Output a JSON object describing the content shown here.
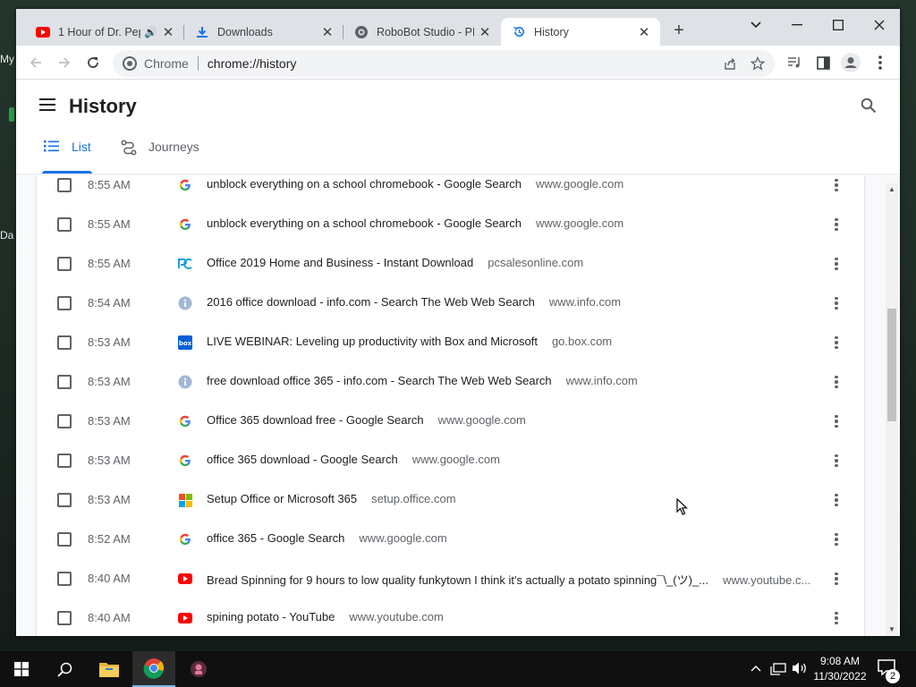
{
  "desktop": {
    "fragment_1": "My",
    "fragment_2": "Da"
  },
  "tabs": [
    {
      "title": "1 Hour of Dr. Pep",
      "icon": "youtube-icon",
      "audio": "🔊"
    },
    {
      "title": "Downloads",
      "icon": "download-icon"
    },
    {
      "title": "RoboBot Studio - PR",
      "icon": "robobot-icon"
    },
    {
      "title": "History",
      "icon": "history-icon",
      "active": true
    }
  ],
  "new_tab_label": "+",
  "toolbar": {
    "omnibox_label": "Chrome",
    "url": "chrome://history"
  },
  "page": {
    "title": "History",
    "tabs": [
      {
        "label": "List",
        "active": true
      },
      {
        "label": "Journeys",
        "active": false
      }
    ]
  },
  "history": [
    {
      "time": "8:55 AM",
      "title": "unblock everything on a school chromebook - Google Search",
      "domain": "www.google.com",
      "icon": "google-icon"
    },
    {
      "time": "8:55 AM",
      "title": "unblock everything on a school chromebook - Google Search",
      "domain": "www.google.com",
      "icon": "google-icon"
    },
    {
      "time": "8:55 AM",
      "title": "Office 2019 Home and Business - Instant Download",
      "domain": "pcsalesonline.com",
      "icon": "pcsales-icon"
    },
    {
      "time": "8:54 AM",
      "title": "2016 office download - info.com - Search The Web Web Search",
      "domain": "www.info.com",
      "icon": "info-icon"
    },
    {
      "time": "8:53 AM",
      "title": "LIVE WEBINAR: Leveling up productivity with Box and Microsoft",
      "domain": "go.box.com",
      "icon": "box-icon"
    },
    {
      "time": "8:53 AM",
      "title": "free download office 365 - info.com - Search The Web Web Search",
      "domain": "www.info.com",
      "icon": "info-icon"
    },
    {
      "time": "8:53 AM",
      "title": "Office 365 download free - Google Search",
      "domain": "www.google.com",
      "icon": "google-icon"
    },
    {
      "time": "8:53 AM",
      "title": "office 365 download - Google Search",
      "domain": "www.google.com",
      "icon": "google-icon"
    },
    {
      "time": "8:53 AM",
      "title": "Setup Office or Microsoft 365",
      "domain": "setup.office.com",
      "icon": "microsoft-icon"
    },
    {
      "time": "8:52 AM",
      "title": "office 365 - Google Search",
      "domain": "www.google.com",
      "icon": "google-icon"
    },
    {
      "time": "8:40 AM",
      "title": "Bread Spinning for 9 hours to low quality funkytown I think it's actually a potato spinning¯\\_(ツ)_...",
      "domain": "www.youtube.c...",
      "icon": "youtube-icon"
    },
    {
      "time": "8:40 AM",
      "title": "spining potato - YouTube",
      "domain": "www.youtube.com",
      "icon": "youtube-icon"
    }
  ],
  "taskbar": {
    "time": "9:08 AM",
    "date": "11/30/2022",
    "notification_count": "2"
  },
  "colors": {
    "accent": "#1a73e8",
    "youtube": "#ff0000",
    "box": "#0061d5"
  }
}
